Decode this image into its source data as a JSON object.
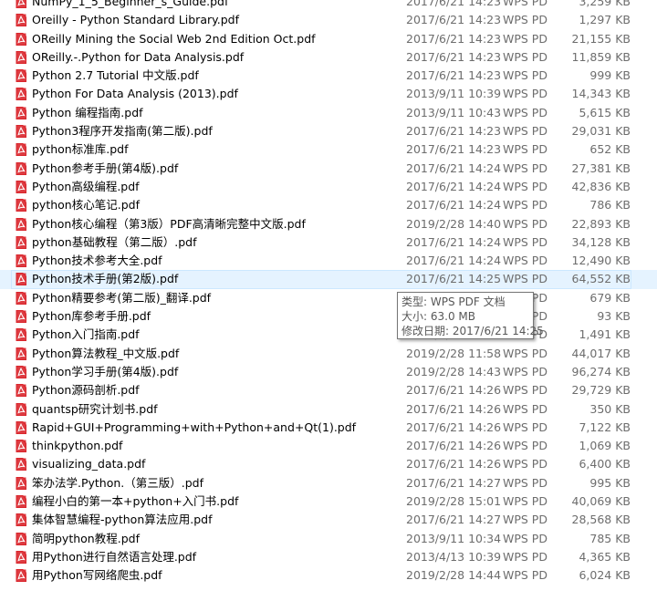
{
  "file_type": "WPS PDF ...",
  "selected_index": 15,
  "files": [
    {
      "name": "NumPy_1_5_Beginner_s_Guide.pdf",
      "date": "2017/6/21 14:23",
      "size": "3,259 KB"
    },
    {
      "name": "Oreilly - Python Standard Library.pdf",
      "date": "2017/6/21 14:23",
      "size": "1,297 KB"
    },
    {
      "name": "OReilly Mining the Social Web 2nd Edition Oct.pdf",
      "date": "2017/6/21 14:23",
      "size": "21,155 KB"
    },
    {
      "name": "OReilly.-.Python for Data Analysis.pdf",
      "date": "2017/6/21 14:23",
      "size": "11,859 KB"
    },
    {
      "name": "Python 2.7 Tutorial 中文版.pdf",
      "date": "2017/6/21 14:23",
      "size": "999 KB"
    },
    {
      "name": "Python For Data Analysis (2013).pdf",
      "date": "2013/9/11 10:39",
      "size": "14,343 KB"
    },
    {
      "name": "Python 编程指南.pdf",
      "date": "2013/9/11 10:43",
      "size": "5,615 KB"
    },
    {
      "name": "Python3程序开发指南(第二版).pdf",
      "date": "2017/6/21 14:23",
      "size": "29,031 KB"
    },
    {
      "name": "python标准库.pdf",
      "date": "2017/6/21 14:23",
      "size": "652 KB"
    },
    {
      "name": "Python参考手册(第4版).pdf",
      "date": "2017/6/21 14:24",
      "size": "27,381 KB"
    },
    {
      "name": "Python高级编程.pdf",
      "date": "2017/6/21 14:24",
      "size": "42,836 KB"
    },
    {
      "name": "python核心笔记.pdf",
      "date": "2017/6/21 14:24",
      "size": "786 KB"
    },
    {
      "name": "Python核心编程（第3版）PDF高清晰完整中文版.pdf",
      "date": "2019/2/28 14:40",
      "size": "22,893 KB"
    },
    {
      "name": "python基础教程（第二版）.pdf",
      "date": "2017/6/21 14:24",
      "size": "34,128 KB"
    },
    {
      "name": "Python技术参考大全.pdf",
      "date": "2017/6/21 14:24",
      "size": "12,490 KB"
    },
    {
      "name": "Python技术手册(第2版).pdf",
      "date": "2017/6/21 14:25",
      "size": "64,552 KB"
    },
    {
      "name": "Python精要参考(第二版)_翻译.pdf",
      "date": "2017/6/21 14:25",
      "size": "679 KB"
    },
    {
      "name": "Python库参考手册.pdf",
      "date": "2017/6/21 14:25",
      "size": "93 KB"
    },
    {
      "name": "Python入门指南.pdf",
      "date": "2017/6/21 14:25",
      "size": "1,491 KB"
    },
    {
      "name": "Python算法教程_中文版.pdf",
      "date": "2019/2/28 11:58",
      "size": "44,017 KB"
    },
    {
      "name": "Python学习手册(第4版).pdf",
      "date": "2019/2/28 14:43",
      "size": "96,274 KB"
    },
    {
      "name": "Python源码剖析.pdf",
      "date": "2017/6/21 14:26",
      "size": "29,729 KB"
    },
    {
      "name": "quantsp研究计划书.pdf",
      "date": "2017/6/21 14:26",
      "size": "350 KB"
    },
    {
      "name": "Rapid+GUI+Programming+with+Python+and+Qt(1).pdf",
      "date": "2017/6/21 14:26",
      "size": "7,122 KB"
    },
    {
      "name": "thinkpython.pdf",
      "date": "2017/6/21 14:26",
      "size": "1,069 KB"
    },
    {
      "name": "visualizing_data.pdf",
      "date": "2017/6/21 14:26",
      "size": "6,400 KB"
    },
    {
      "name": "笨办法学.Python.（第三版）.pdf",
      "date": "2017/6/21 14:27",
      "size": "995 KB"
    },
    {
      "name": "编程小白的第一本+python+入门书.pdf",
      "date": "2019/2/28 15:01",
      "size": "40,069 KB"
    },
    {
      "name": "集体智慧编程-python算法应用.pdf",
      "date": "2017/6/21 14:27",
      "size": "28,568 KB"
    },
    {
      "name": "简明python教程.pdf",
      "date": "2013/9/11 10:34",
      "size": "785 KB"
    },
    {
      "name": "用Python进行自然语言处理.pdf",
      "date": "2013/4/13 10:39",
      "size": "4,365 KB"
    },
    {
      "name": "用Python写网络爬虫.pdf",
      "date": "2019/2/28 14:44",
      "size": "6,024 KB"
    }
  ],
  "tooltip": {
    "type_line": "类型: WPS PDF 文档",
    "size_line": "大小: 63.0 MB",
    "date_line": "修改日期: 2017/6/21 14:25"
  },
  "colors": {
    "pdf_icon": "#d9262c",
    "selection": "#e5f3ff",
    "secondary_text": "#6d6d6d"
  }
}
